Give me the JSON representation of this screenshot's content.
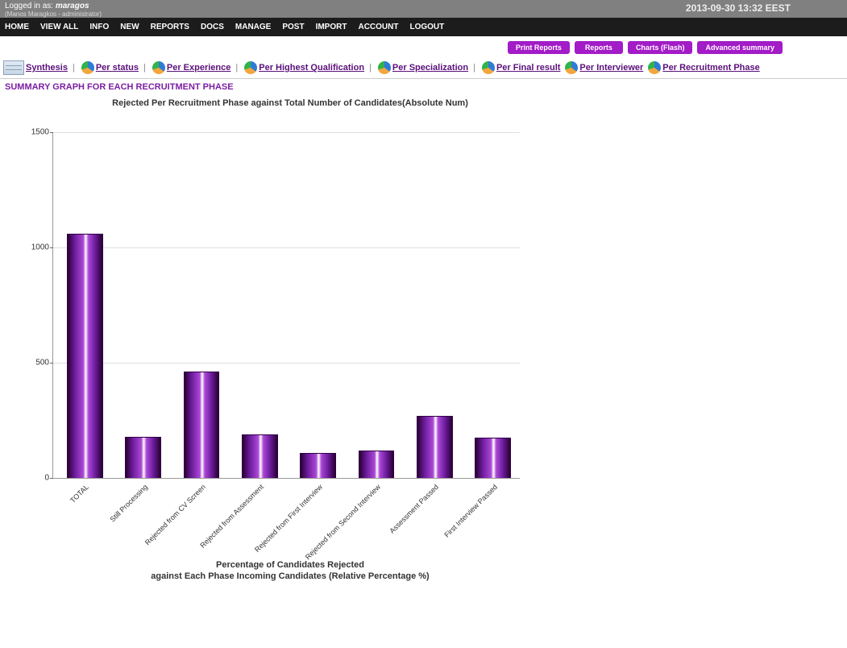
{
  "topbar": {
    "logged_in_prefix": "Logged in as: ",
    "username": "maragos",
    "subline": "(Manos Maragkos - administrator)",
    "timestamp": "2013-09-30 13:32 EEST"
  },
  "menu": [
    "HOME",
    "VIEW ALL",
    "INFO",
    "NEW",
    "REPORTS",
    "DOCS",
    "MANAGE",
    "POST",
    "IMPORT",
    "ACCOUNT",
    "LOGOUT"
  ],
  "purple_buttons": [
    "Print Reports",
    "Reports",
    "Charts (Flash)",
    "Advanced summary"
  ],
  "tabs": [
    "Synthesis",
    "Per status",
    "Per Experience",
    "Per Highest Qualification",
    "Per Specialization",
    "Per Final result",
    "Per Interviewer",
    "Per Recruitment Phase"
  ],
  "section_title": "SUMMARY GRAPH FOR EACH RECRUITMENT PHASE",
  "chart_title": "Rejected Per Recruitment Phase against Total Number of Candidates(Absolute Num)",
  "second_chart_title_line1": "Percentage of Candidates Rejected",
  "second_chart_title_line2": "against Each Phase Incoming Candidates (Relative Percentage %)",
  "chart_data": {
    "type": "bar",
    "title": "Rejected Per Recruitment Phase against Total Number of Candidates(Absolute Num)",
    "xlabel": "",
    "ylabel": "",
    "ylim": [
      0,
      1500
    ],
    "yticks": [
      0,
      500,
      1000,
      1500
    ],
    "categories": [
      "TOTAL",
      "Still Processing",
      "Rejected from CV Screen",
      "Rejected from Assessment",
      "Rejected from First Interview",
      "Rejected from Second Interview",
      "Assessment Passed",
      "First Interview Passed"
    ],
    "values": [
      1060,
      180,
      460,
      190,
      110,
      120,
      270,
      175
    ]
  }
}
